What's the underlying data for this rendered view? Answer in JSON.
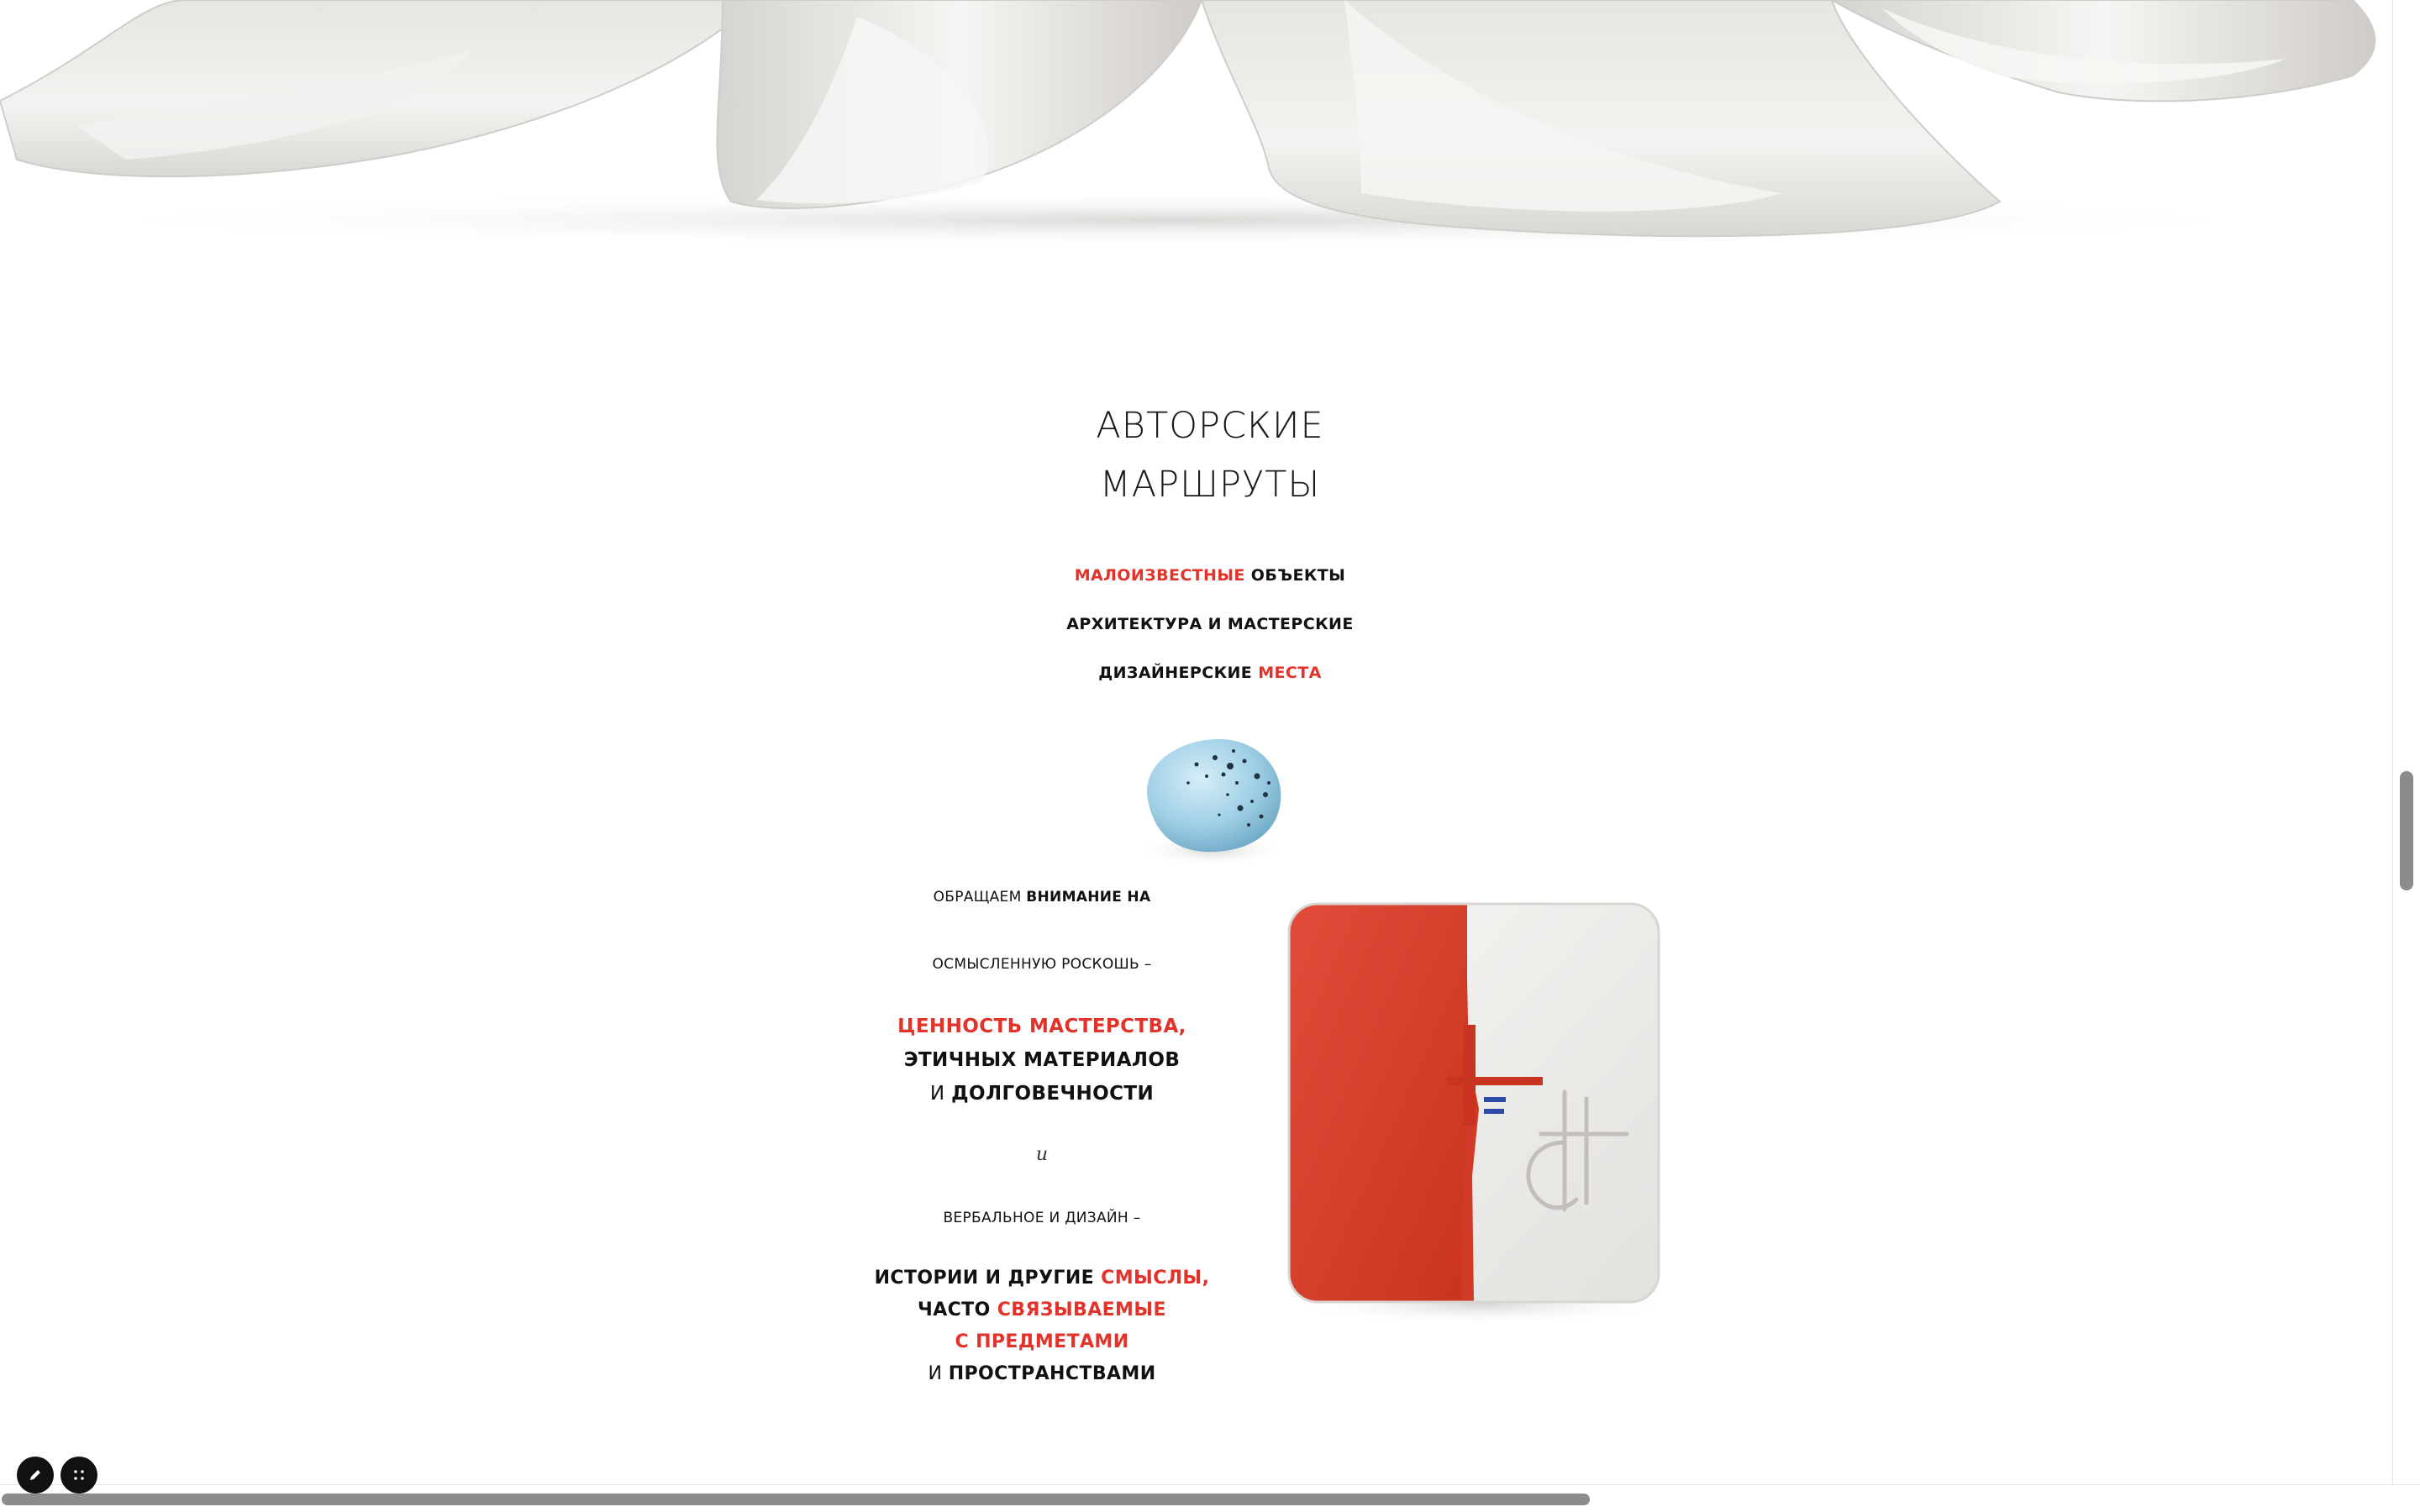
{
  "section": {
    "title_line1": "АВТОРСКИЕ",
    "title_line2": "МАРШРУТЫ"
  },
  "taglines": {
    "line1_red": "МАЛОИЗВЕСТНЫЕ",
    "line1_black": " ОБЪЕКТЫ",
    "line2": "АРХИТЕКТУРА И МАСТЕРСКИЕ",
    "line3_black": "ДИЗАЙНЕРСКИЕ ",
    "line3_red": "МЕСТА"
  },
  "column": {
    "p1_light": "ОБРАЩАЕМ ",
    "p1_bold": "ВНИМАНИЕ НА",
    "p2": "ОСМЫСЛЕННУЮ РОСКОШЬ –",
    "p3_line1": "ЦЕННОСТЬ МАСТЕРСТВА,",
    "p3_line2": "ЭТИЧНЫХ МАТЕРИАЛОВ",
    "p3_line3_light": "И ",
    "p3_line3_bold": "ДОЛГОВЕЧНОСТИ",
    "conj": "и",
    "p4": "ВЕРБАЛЬНОЕ И ДИЗАЙН –",
    "p5_line1_black": "ИСТОРИИ И ДРУГИЕ ",
    "p5_line1_red": "СМЫСЛЫ,",
    "p5_line2_black": "ЧАСТО ",
    "p5_line2_red": "СВЯЗЫВАЕМЫЕ",
    "p5_line3_red": "С ПРЕДМЕТАМИ",
    "p5_line4_light": "И ",
    "p5_line4_bold": "ПРОСТРАНСТВАМИ"
  },
  "colors": {
    "accent_red": "#e2322a",
    "text": "#111111",
    "background": "#ffffff"
  },
  "icons": {
    "edit": "pencil-icon",
    "fullscreen": "grid-dots-icon"
  }
}
